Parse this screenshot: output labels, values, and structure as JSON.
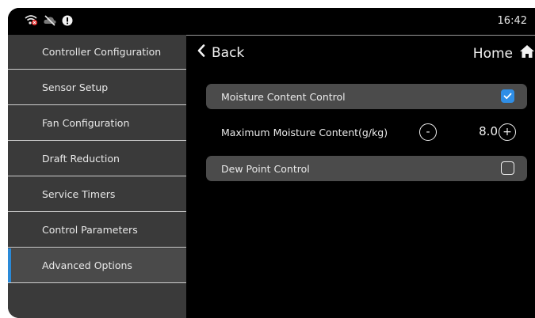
{
  "status": {
    "time": "16:42",
    "icons": [
      "wifi-error-icon",
      "cloud-off-icon",
      "alert-icon"
    ]
  },
  "sidebar": {
    "items": [
      {
        "label": "Controller Configuration",
        "active": false
      },
      {
        "label": "Sensor Setup",
        "active": false
      },
      {
        "label": "Fan Configuration",
        "active": false
      },
      {
        "label": "Draft Reduction",
        "active": false
      },
      {
        "label": "Service Timers",
        "active": false
      },
      {
        "label": "Control Parameters",
        "active": false
      },
      {
        "label": "Advanced Options",
        "active": true
      }
    ]
  },
  "header": {
    "back_label": "Back",
    "home_label": "Home"
  },
  "settings": {
    "moisture_control": {
      "label": "Moisture Content Control",
      "checked": true
    },
    "max_moisture": {
      "label": "Maximum Moisture Content(g/kg)",
      "value": "8.0",
      "decrement": "-",
      "increment": "+"
    },
    "dew_point": {
      "label": "Dew Point Control",
      "checked": false
    }
  },
  "colors": {
    "accent": "#2f8ee6",
    "active_indicator": "#2a8ad8",
    "sidebar_bg": "#3a3a3a",
    "card_bg": "#4b4b4b"
  }
}
